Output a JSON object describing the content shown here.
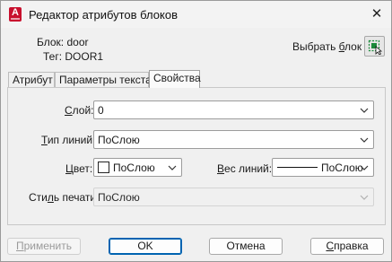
{
  "window": {
    "title": "Редактор атрибутов блоков"
  },
  "header": {
    "block_prefix": "Блок: ",
    "block_value": "door",
    "tag_prefix": "Тег: ",
    "tag_value": "DOOR1",
    "select_block_label_pre": "Выбрать ",
    "select_block_label_u": "б",
    "select_block_label_post": "лок"
  },
  "tabs": [
    {
      "label": "Атрибут",
      "active": false
    },
    {
      "label": "Параметры текста",
      "active": false
    },
    {
      "label": "Свойства",
      "active": true
    }
  ],
  "properties": {
    "layer": {
      "label_u": "С",
      "label_rest": "лой:",
      "value": "0"
    },
    "linetype": {
      "label_u": "Т",
      "label_rest": "ип линий:",
      "value": "ПоСлою"
    },
    "color": {
      "label_u": "Ц",
      "label_rest": "вет:",
      "value": "ПоСлою"
    },
    "lineweight": {
      "label_u": "В",
      "label_rest": "ес линий:",
      "value": "ПоСлою"
    },
    "plotstyle": {
      "label_pre": "Сти",
      "label_u": "л",
      "label_rest": "ь печати:",
      "value": "ПоСлою",
      "disabled": true
    }
  },
  "buttons": {
    "apply": {
      "label_u": "П",
      "label_rest": "рименить",
      "disabled": true
    },
    "ok": "OK",
    "cancel": "Отмена",
    "help": {
      "label_u": "С",
      "label_rest": "правка"
    }
  },
  "colors": {
    "accent": "#0063b1",
    "app_icon": "#c8102e"
  }
}
